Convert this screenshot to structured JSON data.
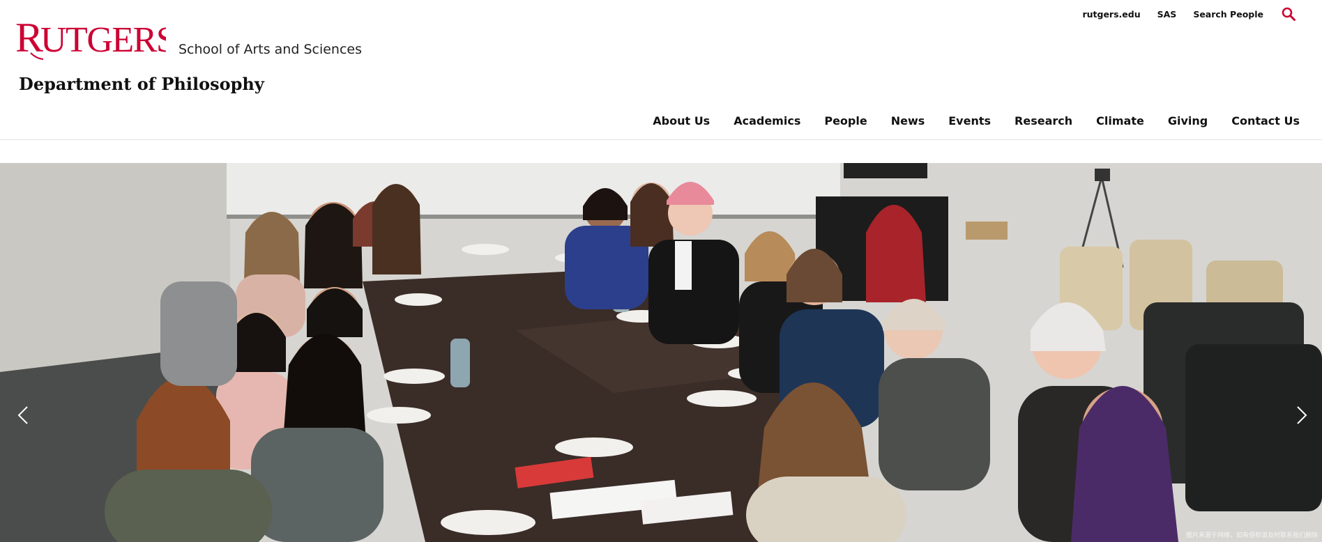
{
  "brand": {
    "wordmark": "RUTGERS",
    "school": "School of Arts and Sciences",
    "department": "Department of Philosophy",
    "accent_color": "#cc0033"
  },
  "utility_nav": {
    "items": [
      "rutgers.edu",
      "SAS",
      "Search People"
    ],
    "search_icon": "search-icon"
  },
  "main_nav": {
    "items": [
      "About Us",
      "Academics",
      "People",
      "News",
      "Events",
      "Research",
      "Climate",
      "Giving",
      "Contact Us"
    ]
  },
  "hero": {
    "prev_icon": "chevron-left-icon",
    "next_icon": "chevron-right-icon",
    "watermark": "图片来源于网络，如有侵权请及时联系我们删除"
  }
}
